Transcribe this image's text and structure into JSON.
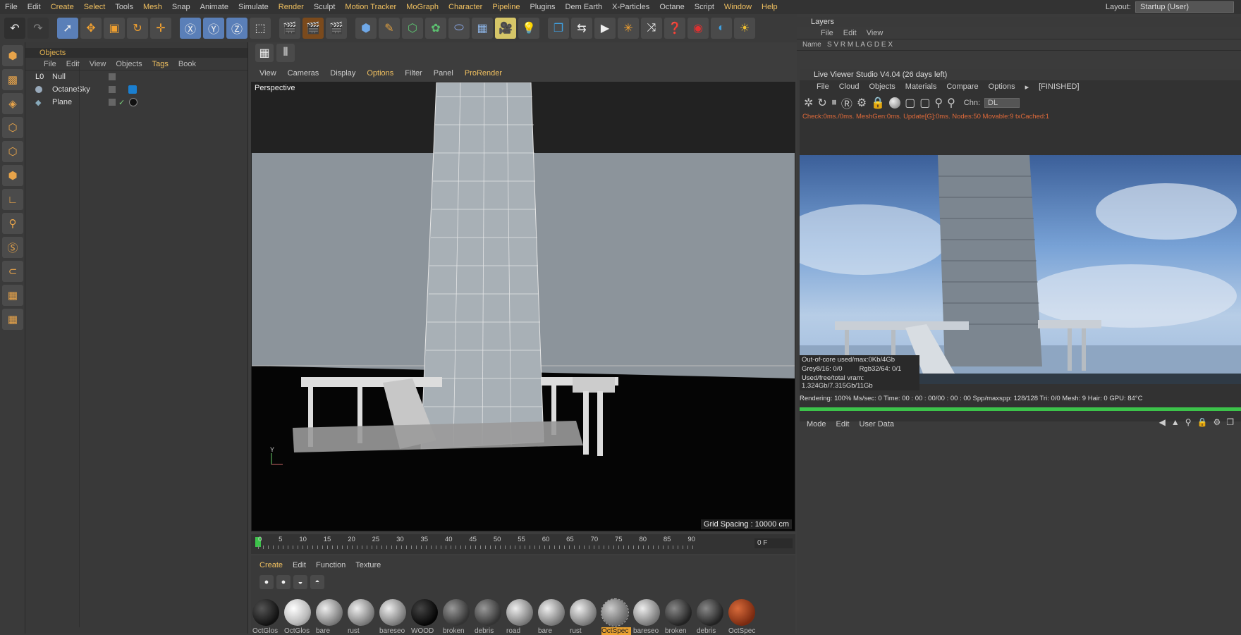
{
  "menubar": {
    "items": [
      "File",
      "Edit",
      "Create",
      "Select",
      "Tools",
      "Mesh",
      "Snap",
      "Animate",
      "Simulate",
      "Render",
      "Sculpt",
      "Motion Tracker",
      "MoGraph",
      "Character",
      "Pipeline",
      "Plugins",
      "Dem Earth",
      "X-Particles",
      "Octane",
      "Script",
      "Window",
      "Help"
    ],
    "layout_label": "Layout:",
    "layout_value": "Startup (User)"
  },
  "objects_panel": {
    "title": "Objects",
    "menu": [
      "File",
      "Edit",
      "View",
      "Objects",
      "Tags",
      "Book"
    ],
    "items": [
      {
        "name": "Null"
      },
      {
        "name": "OctaneSky"
      },
      {
        "name": "Plane"
      }
    ]
  },
  "viewport": {
    "menu": [
      "View",
      "Cameras",
      "Display",
      "Options",
      "Filter",
      "Panel",
      "ProRender"
    ],
    "label": "Perspective",
    "grid_spacing": "Grid Spacing : 10000 cm",
    "timeline_ticks": [
      "0",
      "5",
      "10",
      "15",
      "20",
      "25",
      "30",
      "35",
      "40",
      "45",
      "50",
      "55",
      "60",
      "65",
      "70",
      "75",
      "80",
      "85",
      "90"
    ],
    "frame": "0 F"
  },
  "material_panel": {
    "menu": [
      "Create",
      "Edit",
      "Function",
      "Texture"
    ],
    "materials": [
      "OctGlos",
      "OctGlos",
      "bare",
      "rust",
      "bareseo",
      "WOOD",
      "broken",
      "debris",
      "road",
      "bare",
      "rust",
      "OctSpec",
      "bareseo",
      "broken",
      "debris",
      "OctSpec"
    ]
  },
  "layers_panel": {
    "title": "Layers",
    "menu": [
      "File",
      "Edit",
      "View"
    ],
    "columns": "Name   S V R M L A G D E X"
  },
  "live_viewer": {
    "title": "Live Viewer Studio V4.04 (26 days left)",
    "menu": [
      "File",
      "Cloud",
      "Objects",
      "Materials",
      "Compare",
      "Options"
    ],
    "state": "[FINISHED]",
    "channel_label": "Chn:",
    "channel_value": "DL",
    "check_line": "Check:0ms./0ms. MeshGen:0ms. Update[G]:0ms. Nodes:50 Movable:9 txCached:1",
    "out_of_core": "Out-of-core used/max:0Kb/4Gb",
    "grey": "Grey8/16: 0/0",
    "rgb": "Rgb32/64: 0/1",
    "vram": "Used/free/total vram: 1.324Gb/7.315Gb/11Gb",
    "rendering": "Rendering: 100% Ms/sec: 0   Time: 00 : 00 : 00/00 : 00 : 00   Spp/maxspp: 128/128   Tri: 0/0   Mesh: 9  Hair: 0   GPU:     84°C",
    "progress": 1.0
  },
  "attributes_panel": {
    "menu": [
      "Mode",
      "Edit",
      "User Data"
    ]
  },
  "colors": {
    "accent": "#f0c060",
    "progress": "#3cc34a"
  }
}
